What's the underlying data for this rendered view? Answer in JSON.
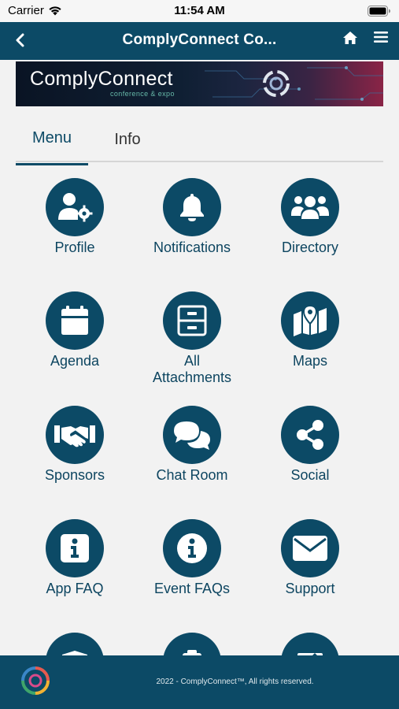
{
  "status_bar": {
    "carrier": "Carrier",
    "time": "11:54 AM"
  },
  "nav": {
    "title": "ComplyConnect Co..."
  },
  "banner": {
    "brand": "ComplyConnect",
    "tagline": "conference & expo"
  },
  "tabs": [
    {
      "label": "Menu",
      "active": true
    },
    {
      "label": "Info",
      "active": false
    }
  ],
  "menu_items": [
    {
      "label": "Profile",
      "icon": "user-gear-icon"
    },
    {
      "label": "Notifications",
      "icon": "bell-icon"
    },
    {
      "label": "Directory",
      "icon": "users-icon"
    },
    {
      "label": "Agenda",
      "icon": "calendar-icon"
    },
    {
      "label": "All Attachments",
      "icon": "cabinet-icon"
    },
    {
      "label": "Maps",
      "icon": "map-icon"
    },
    {
      "label": "Sponsors",
      "icon": "handshake-icon"
    },
    {
      "label": "Chat Room",
      "icon": "chat-icon"
    },
    {
      "label": "Social",
      "icon": "share-icon"
    },
    {
      "label": "App FAQ",
      "icon": "info-square-icon"
    },
    {
      "label": "Event FAQs",
      "icon": "info-circle-icon"
    },
    {
      "label": "Support",
      "icon": "envelope-icon"
    }
  ],
  "footer": {
    "copyright": "2022 - ComplyConnect™, All rights reserved."
  },
  "colors": {
    "primary": "#0c4a66",
    "background": "#f2f2f2"
  }
}
